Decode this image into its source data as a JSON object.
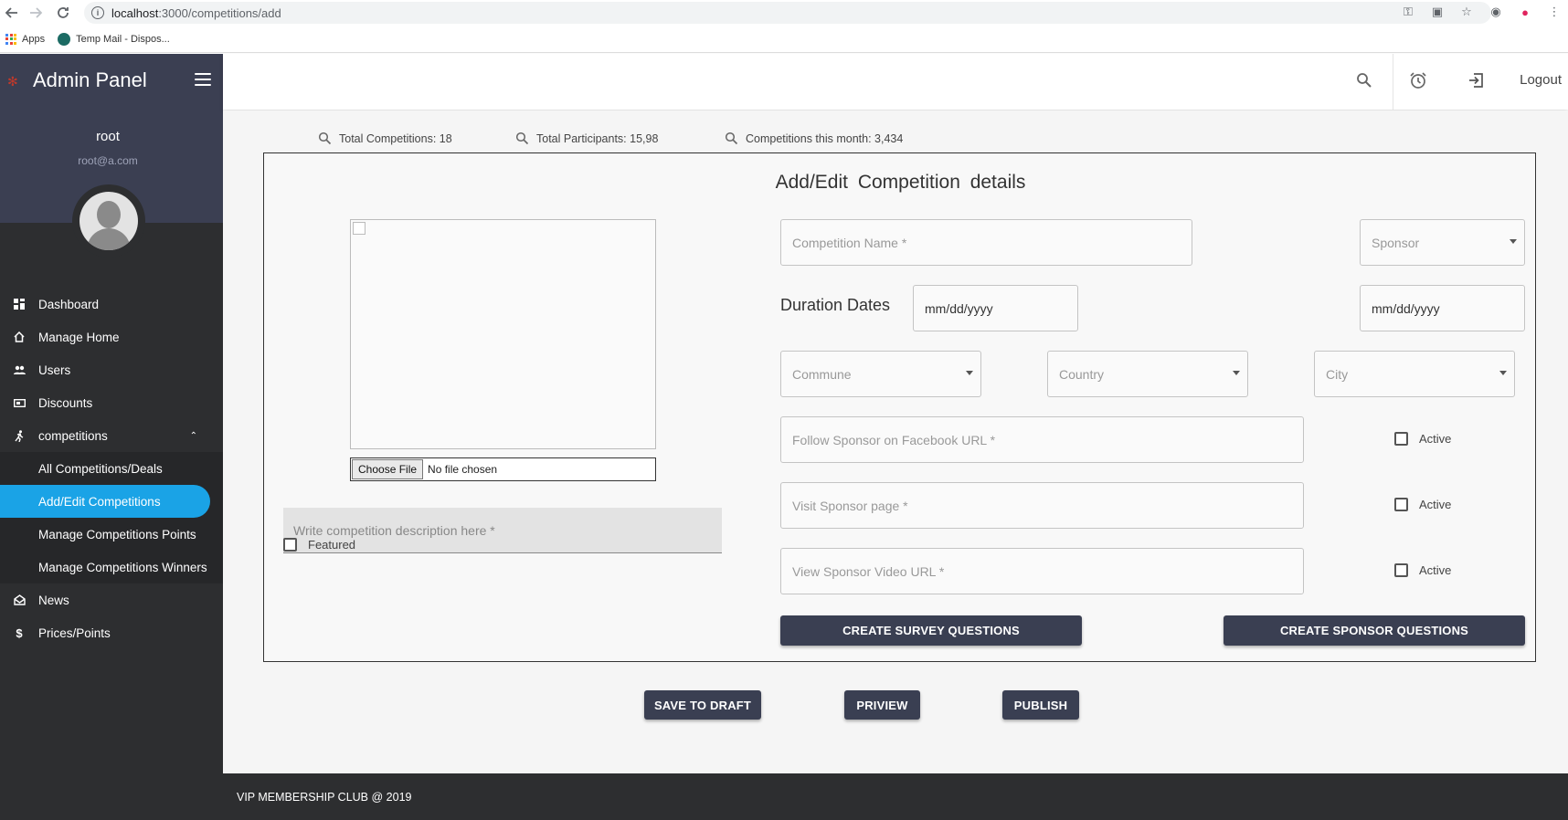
{
  "browser": {
    "url_host": "localhost",
    "url_path": ":3000/competitions/add",
    "bookmarks": [
      {
        "label": "Apps"
      },
      {
        "label": "Temp Mail - Dispos..."
      }
    ]
  },
  "sidebar": {
    "brand": "Admin Panel",
    "user_name": "root",
    "user_email": "root@a.com",
    "items": [
      {
        "label": "Dashboard",
        "icon": "dashboard-icon"
      },
      {
        "label": "Manage Home",
        "icon": "home-icon"
      },
      {
        "label": "Users",
        "icon": "users-icon"
      },
      {
        "label": "Discounts",
        "icon": "ticket-icon"
      },
      {
        "label": "competitions",
        "icon": "running-icon"
      }
    ],
    "sub_items": [
      {
        "label": "All Competitions/Deals"
      },
      {
        "label": "Add/Edit Competitions",
        "active": true
      },
      {
        "label": "Manage Competitions Points"
      },
      {
        "label": "Manage Competitions Winners"
      }
    ],
    "items_after": [
      {
        "label": "News",
        "icon": "mail-open-icon"
      },
      {
        "label": "Prices/Points",
        "icon": "dollar-icon"
      }
    ]
  },
  "header": {
    "logout_label": "Logout"
  },
  "stats": {
    "total_competitions": "Total Competitions: 18",
    "total_participants": "Total Participants: 15,98",
    "this_month": "Competitions this month: 3,434"
  },
  "form": {
    "title": "Add/Edit  Competition  details",
    "file_button": "Choose File",
    "file_status": "No file chosen",
    "description_placeholder": "Write competition description here *",
    "featured_label": "Featured",
    "competition_name_placeholder": "Competition Name *",
    "sponsor_placeholder": "Sponsor",
    "duration_label": "Duration Dates",
    "start_date_placeholder": "mm/dd/yyyy",
    "end_date_placeholder": "mm/dd/yyyy",
    "commune_placeholder": "Commune",
    "country_placeholder": "Country",
    "city_placeholder": "City",
    "facebook_placeholder": "Follow Sponsor on Facebook URL *",
    "sponsor_page_placeholder": "Visit Sponsor page *",
    "video_placeholder": "View Sponsor Video URL *",
    "active_label": "Active",
    "survey_button": "CREATE SURVEY QUESTIONS",
    "sponsor_questions_button": "CREATE SPONSOR QUESTIONS"
  },
  "actions": {
    "save_draft": "SAVE TO DRAFT",
    "preview": "PRIVIEW",
    "publish": "PUBLISH"
  },
  "footer": {
    "text": "VIP MEMBERSHIP CLUB @ 2019"
  },
  "colors": {
    "sidebar_bg": "#2d2e30",
    "sidebar_header_bg": "#3b3f52",
    "active_item": "#1aa3e6",
    "button_dark": "#3a3f52"
  }
}
